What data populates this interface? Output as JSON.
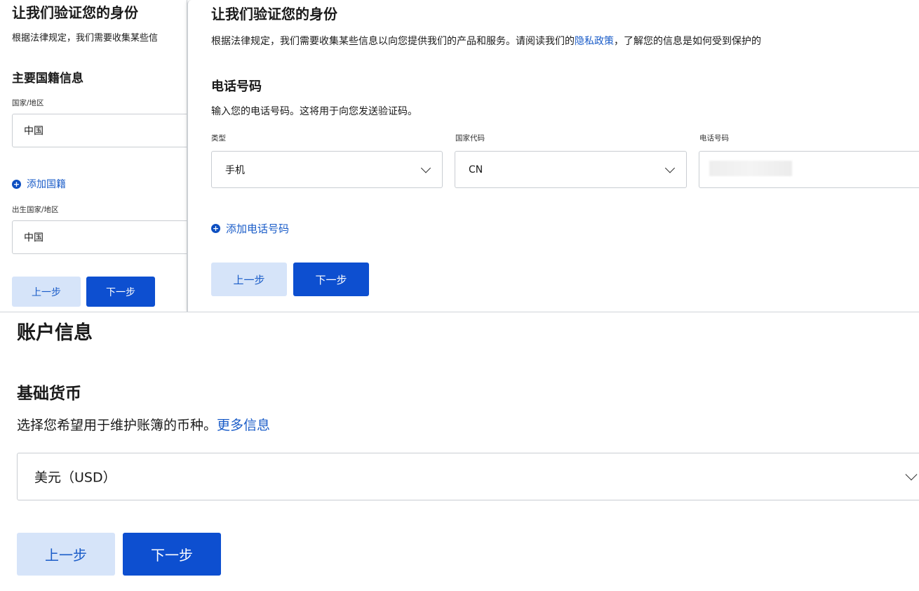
{
  "left_panel": {
    "title": "让我们验证您的身份",
    "desc": "根据法律规定，我们需要收集某些信",
    "section_title": "主要国籍信息",
    "country_label": "国家/地区",
    "country_value": "中国",
    "add_nationality": "添加国籍",
    "birth_label": "出生国家/地区",
    "birth_value": "中国",
    "prev_label": "上一步",
    "next_label": "下一步"
  },
  "phone_panel": {
    "title": "让我们验证您的身份",
    "desc_before": "根据法律规定，我们需要收集某些信息以向您提供我们的产品和服务。请阅读我们的",
    "privacy_link": "隐私政策",
    "desc_after": "，了解您的信息是如何受到保护的",
    "section_title": "电话号码",
    "section_desc": "输入您的电话号码。这将用于向您发送验证码。",
    "type_label": "类型",
    "type_value": "手机",
    "code_label": "国家代码",
    "code_value": "CN",
    "phone_label": "电话号码",
    "add_phone": "添加电话号码",
    "prev_label": "上一步",
    "next_label": "下一步"
  },
  "account_panel": {
    "title": "账户信息",
    "section_title": "基础货币",
    "desc": "选择您希望用于维护账簿的币种。",
    "more_link": "更多信息",
    "currency_value": "美元（USD）",
    "prev_label": "上一步",
    "next_label": "下一步"
  },
  "icons": {
    "plus": "+",
    "chevron": "chevron-down-icon"
  },
  "colors": {
    "primary": "#0d4fd0",
    "secondary_bg": "#d6e4f9",
    "link": "#1a5cc8"
  }
}
